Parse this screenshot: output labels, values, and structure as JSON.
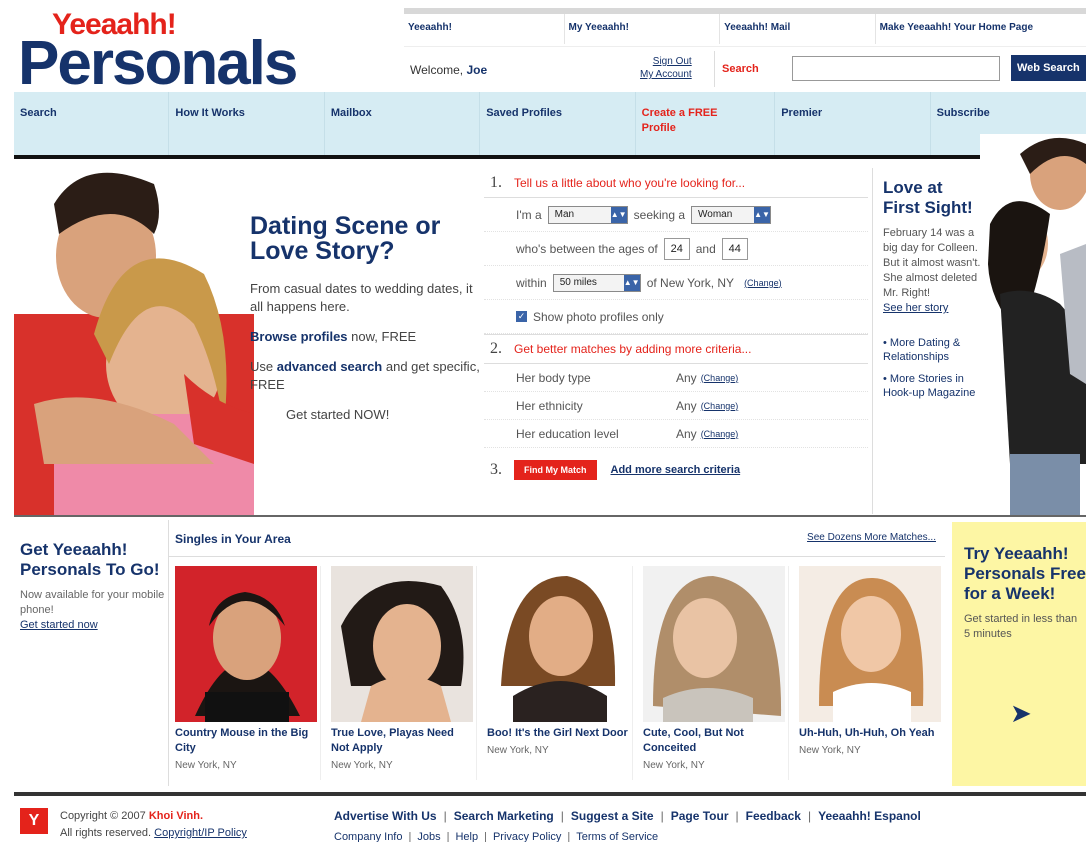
{
  "brand": {
    "top": "Yeeaahh!",
    "main": "Personals"
  },
  "top_links": [
    "Yeeaahh!",
    "My Yeeaahh!",
    "Yeeaahh! Mail",
    "Make Yeeaahh! Your Home Page"
  ],
  "user": {
    "welcome": "Welcome,",
    "name": "Joe",
    "sign_out": "Sign Out",
    "my_account": "My Account"
  },
  "search": {
    "label": "Search",
    "value": "",
    "button": "Web Search"
  },
  "nav": [
    {
      "label": "Search"
    },
    {
      "label": "How It Works"
    },
    {
      "label": "Mailbox"
    },
    {
      "label": "Saved Profiles"
    },
    {
      "label": "Create a FREE Profile"
    },
    {
      "label": "Premier"
    },
    {
      "label": "Subscribe"
    }
  ],
  "hero": {
    "headline": "Dating Scene or Love Story?",
    "para1": "From casual dates to wedding dates, it all happens here.",
    "browse_link": "Browse profiles",
    "browse_rest": " now, FREE",
    "use": "Use ",
    "adv_link": "advanced search",
    "adv_rest": " and get specific, FREE",
    "cta": "Get started NOW!"
  },
  "form": {
    "step1_num": "1.",
    "step1": "Tell us a little about who you're looking for...",
    "im_a": "I'm a",
    "gender": "Man",
    "seeking": "seeking a",
    "seeking_gender": "Woman",
    "ages_label": "who's between the ages of",
    "age_min": "24",
    "and": "and",
    "age_max": "44",
    "within": "within",
    "distance": "50 miles",
    "of_location": "of New York, NY",
    "change": "(Change)",
    "photo_only": "Show photo profiles only",
    "step2_num": "2.",
    "step2": "Get better matches by adding more criteria...",
    "criteria": [
      {
        "label": "Her body type",
        "value": "Any"
      },
      {
        "label": "Her ethnicity",
        "value": "Any"
      },
      {
        "label": "Her education level",
        "value": "Any"
      }
    ],
    "step3_num": "3.",
    "find_button": "Find My Match",
    "add_criteria": "Add more search criteria"
  },
  "love": {
    "title": "Love at First Sight!",
    "story": "February 14 was a big day for Colleen. But it almost wasn't. She almost deleted Mr. Right!",
    "story_link": "See her story",
    "links": [
      "• More Dating & Relationships",
      "• More Stories in Hook-up Magazine"
    ]
  },
  "mobile": {
    "title": "Get Yeeaahh! Personals To Go!",
    "text": "Now available for your mobile phone!",
    "link": "Get started now"
  },
  "singles": {
    "title": "Singles in Your Area",
    "more_link": "See Dozens More Matches...",
    "cards": [
      {
        "caption": "Country Mouse in the Big City",
        "location": "New York, NY"
      },
      {
        "caption": "True Love, Playas Need Not Apply",
        "location": "New York, NY"
      },
      {
        "caption": "Boo! It's the Girl Next Door",
        "location": "New York, NY"
      },
      {
        "caption": "Cute, Cool, But Not Conceited",
        "location": "New York, NY"
      },
      {
        "caption": "Uh-Huh, Uh-Huh, Oh Yeah",
        "location": "New York, NY"
      }
    ]
  },
  "try": {
    "title": "Try Yeeaahh! Personals Free for a Week!",
    "text": "Get started in less than 5 minutes"
  },
  "footer": {
    "copyright": "Copyright © 2007",
    "author": "Khoi Vinh.",
    "rights": "All rights reserved.",
    "policy": "Copyright/IP Policy",
    "links1": [
      "Advertise With Us",
      "Search Marketing",
      "Suggest a Site",
      "Page Tour",
      "Feedback",
      "Yeeaahh! Espanol"
    ],
    "links2": [
      "Company Info",
      "Jobs",
      "Help",
      "Privacy Policy",
      "Terms of Service"
    ]
  },
  "colors": {
    "brand_blue": "#16336b",
    "brand_red": "#e4231b",
    "nav_bg": "#d6ecf3",
    "promo_yellow": "#fdf6a4"
  }
}
